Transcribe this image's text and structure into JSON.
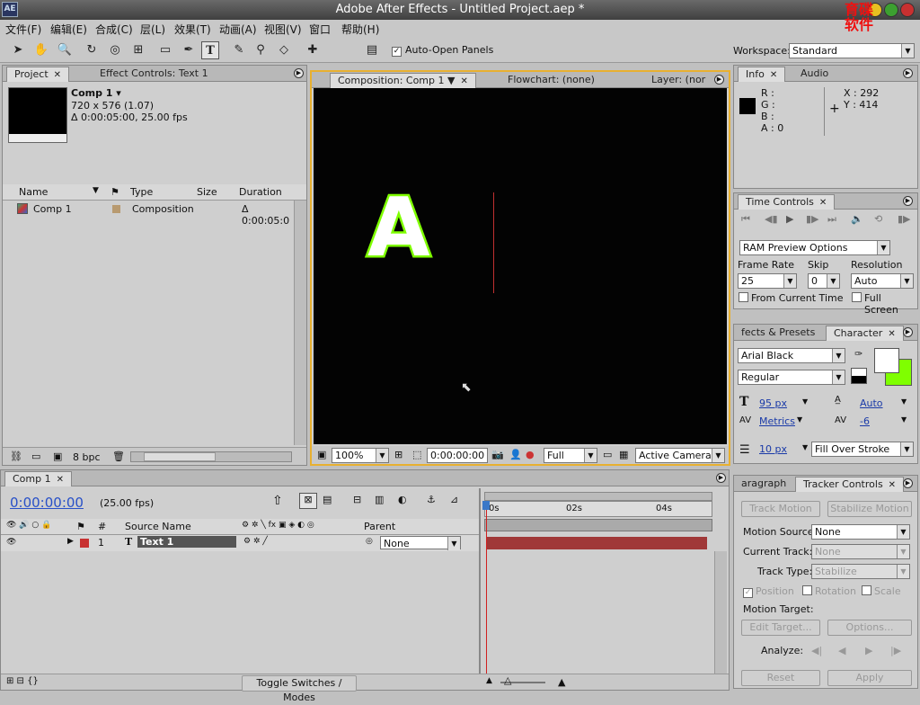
{
  "app": {
    "title": "Adobe After Effects - Untitled Project.aep *",
    "logo": "AE",
    "watermark": "育碟\n软件"
  },
  "menu": [
    "文件(F)",
    "编辑(E)",
    "合成(C)",
    "层(L)",
    "效果(T)",
    "动画(A)",
    "视图(V)",
    "窗口",
    "帮助(H)"
  ],
  "toolbar": {
    "auto_open_label": "Auto-Open Panels",
    "auto_open_checked": true,
    "workspace_label": "Workspace:",
    "workspace_value": "Standard",
    "tools": [
      "selection-tool-icon",
      "hand-tool-icon",
      "zoom-tool-icon",
      "rotation-tool-icon",
      "orbit-camera-icon",
      "pan-behind-icon",
      "rectangle-mask-icon",
      "pen-tool-icon",
      "type-tool-icon",
      "brush-tool-icon",
      "clone-stamp-icon",
      "eraser-icon",
      "puppet-pin-icon"
    ]
  },
  "project": {
    "tabs": [
      "Project",
      "Effect Controls: Text 1"
    ],
    "comp_name": "Comp 1 ▾",
    "comp_dims": "720 x 576 (1.07)",
    "comp_duration": "Δ 0:00:05:00, 25.00 fps",
    "columns": [
      "Name",
      "Type",
      "Size",
      "Duration"
    ],
    "items": [
      {
        "name": "Comp 1",
        "type": "Composition",
        "size": "",
        "duration": "Δ 0:00:05:0"
      }
    ],
    "bpc": "8 bpc"
  },
  "composition": {
    "tabs": [
      "Composition: Comp 1",
      "Flowchart: (none)",
      "Layer: (nor"
    ],
    "text_glyph": "A",
    "zoom": "100%",
    "timecode": "0:00:00:00",
    "resolution": "Full",
    "camera": "Active Camera"
  },
  "info": {
    "tabs": [
      "Info",
      "Audio"
    ],
    "r": "R :",
    "g": "G :",
    "b": "B :",
    "a": "A : 0",
    "x": "X : 292",
    "y": "Y : 414"
  },
  "time_controls": {
    "tab": "Time Controls",
    "ram_preview": "RAM Preview Options",
    "frame_rate_label": "Frame Rate",
    "frame_rate": "25",
    "skip_label": "Skip",
    "skip": "0",
    "resolution_label": "Resolution",
    "resolution": "Auto",
    "from_current": "From Current Time",
    "full_screen": "Full Screen"
  },
  "character": {
    "tabs": [
      "fects & Presets",
      "Character"
    ],
    "font": "Arial Black",
    "style": "Regular",
    "size": "95 px",
    "leading": "Auto",
    "kerning": "Metrics",
    "tracking": "-6",
    "stroke_width": "10 px",
    "stroke_mode": "Fill Over Stroke",
    "fill_color": "#ffffff",
    "stroke_color": "#7fff00"
  },
  "tracker": {
    "tabs": [
      "aragraph",
      "Tracker Controls"
    ],
    "track_motion": "Track Motion",
    "stabilize_motion": "Stabilize Motion",
    "motion_source_label": "Motion Source:",
    "motion_source": "None",
    "current_track_label": "Current Track:",
    "current_track": "None",
    "track_type_label": "Track Type:",
    "track_type": "Stabilize",
    "position": "Position",
    "rotation": "Rotation",
    "scale": "Scale",
    "motion_target_label": "Motion Target:",
    "edit_target": "Edit Target...",
    "options": "Options...",
    "analyze_label": "Analyze:",
    "reset": "Reset",
    "apply": "Apply"
  },
  "timeline": {
    "tab": "Comp 1",
    "timecode": "0:00:00:00",
    "fps": "(25.00 fps)",
    "columns": [
      "#",
      "Source Name",
      "Parent"
    ],
    "layers": [
      {
        "num": "1",
        "name": "Text 1",
        "parent": "None",
        "label_color": "#c83232"
      }
    ],
    "ruler_marks": [
      "0s",
      "02s",
      "04s"
    ],
    "toggle_label": "Toggle Switches / Modes"
  }
}
